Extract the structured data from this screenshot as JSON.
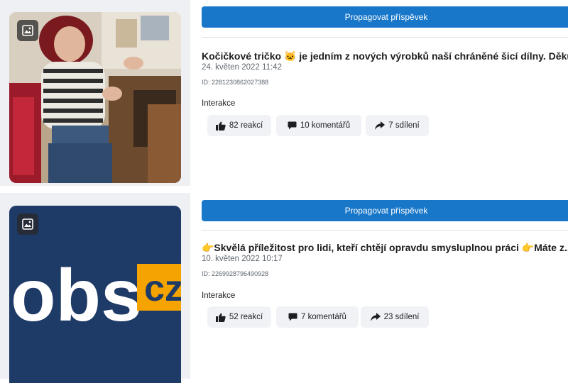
{
  "posts": [
    {
      "promote_label": "Propagovat příspěvek",
      "title": "Kočičkové tričko 🐱 je jedním z nových výrobků naší chráněné šicí dílny. Děku...",
      "date": "24. květen 2022 11:42",
      "id": "ID: 2281230862027388",
      "interactions_label": "Interakce",
      "reactions": "82 reakcí",
      "comments": "10 komentářů",
      "shares": "7 sdílení",
      "thumb_icon": "photo-icon"
    },
    {
      "promote_label": "Propagovat příspěvek",
      "title": "👉Skvělá příležitost pro lidi, kteří chtějí opravdu smysluplnou práci 👉Máte z...",
      "date": "10. květen 2022 10:17",
      "id": "ID: 2269928796490928",
      "interactions_label": "Interakce",
      "reactions": "52 reakcí",
      "comments": "7 komentářů",
      "shares": "23 sdílení",
      "thumb_icon": "photo-icon",
      "thumb_logo_text": "obs",
      "thumb_logo_badge": "cz"
    }
  ],
  "colors": {
    "accent": "#1877c9",
    "button_bg": "#f0f2f5",
    "logo_bg": "#1e3a66",
    "logo_badge": "#f5a300"
  }
}
